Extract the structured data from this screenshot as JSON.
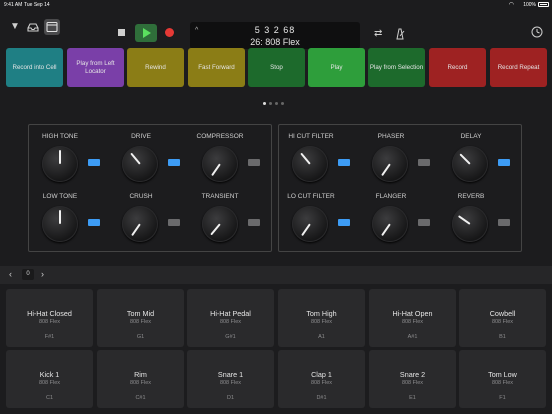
{
  "status_bar": {
    "time": "9:41 AM",
    "date": "Tue Sep 14",
    "battery": "100%"
  },
  "toolbar": {
    "position": "5 3 2     68",
    "patch": "26: 808 Flex",
    "caret": "^"
  },
  "remote_pads": [
    {
      "label": "Record into Cell",
      "color": "#1f7f84"
    },
    {
      "label": "Play from Left Locator",
      "color": "#7a3fa8"
    },
    {
      "label": "Rewind",
      "color": "#8b7d16"
    },
    {
      "label": "Fast Forward",
      "color": "#8b7d16"
    },
    {
      "label": "Stop",
      "color": "#1d6a2c"
    },
    {
      "label": "Play",
      "color": "#2e9e3b"
    },
    {
      "label": "Play from Selection",
      "color": "#1d6a2c"
    },
    {
      "label": "Record",
      "color": "#9e2222"
    },
    {
      "label": "Record Repeat",
      "color": "#9e2222"
    }
  ],
  "fx_left": {
    "high_tone": "HIGH TONE",
    "drive": "DRIVE",
    "compressor": "COMPRESSOR",
    "low_tone": "LOW TONE",
    "crush": "CRUSH",
    "transient": "TRANSIENT"
  },
  "fx_right": {
    "hi_cut": "HI CUT FILTER",
    "phaser": "PHASER",
    "delay": "DELAY",
    "lo_cut": "LO CUT FILTER",
    "flanger": "FLANGER",
    "reverb": "REVERB"
  },
  "grid": {
    "page": "0"
  },
  "drums": [
    {
      "name": "Hi-Hat Closed",
      "kit": "808 Flex",
      "note": "F#1"
    },
    {
      "name": "Tom Mid",
      "kit": "808 Flex",
      "note": "G1"
    },
    {
      "name": "Hi-Hat Pedal",
      "kit": "808 Flex",
      "note": "G#1"
    },
    {
      "name": "Tom High",
      "kit": "808 Flex",
      "note": "A1"
    },
    {
      "name": "Hi-Hat Open",
      "kit": "808 Flex",
      "note": "A#1"
    },
    {
      "name": "Cowbell",
      "kit": "808 Flex",
      "note": "B1"
    },
    {
      "name": "Kick 1",
      "kit": "808 Flex",
      "note": "C1"
    },
    {
      "name": "Rim",
      "kit": "808 Flex",
      "note": "C#1"
    },
    {
      "name": "Snare 1",
      "kit": "808 Flex",
      "note": "D1"
    },
    {
      "name": "Clap 1",
      "kit": "808 Flex",
      "note": "D#1"
    },
    {
      "name": "Snare 2",
      "kit": "808 Flex",
      "note": "E1"
    },
    {
      "name": "Tom Low",
      "kit": "808 Flex",
      "note": "F1"
    }
  ]
}
